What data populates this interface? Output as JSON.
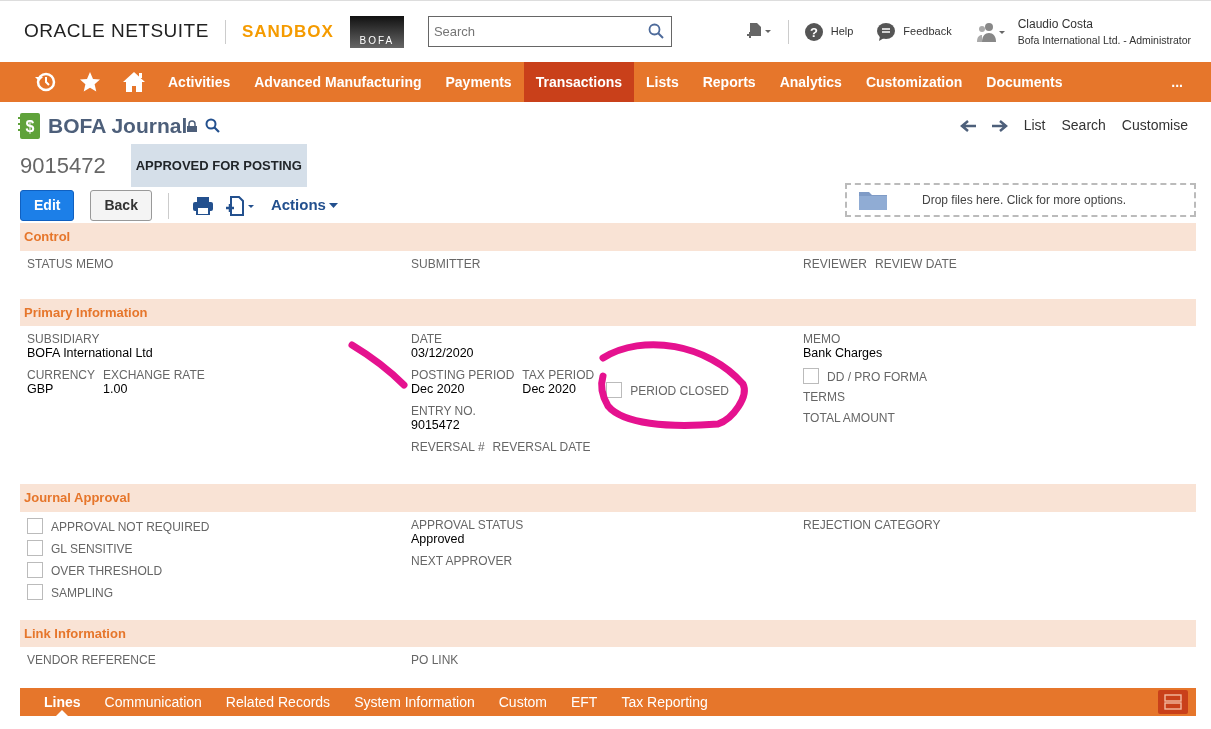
{
  "header": {
    "brand": "ORACLE NETSUITE",
    "environment": "SANDBOX",
    "company_logo": "BOFA",
    "search": {
      "placeholder": "Search"
    },
    "help_glyph": "?",
    "help": "Help",
    "feedback": "Feedback",
    "user": {
      "name": "Claudio Costa",
      "role": "Bofa International Ltd. - Administrator"
    }
  },
  "nav": {
    "items": [
      {
        "label": "Activities",
        "selected": false
      },
      {
        "label": "Advanced Manufacturing",
        "selected": false
      },
      {
        "label": "Payments",
        "selected": false
      },
      {
        "label": "Transactions",
        "selected": true
      },
      {
        "label": "Lists",
        "selected": false
      },
      {
        "label": "Reports",
        "selected": false
      },
      {
        "label": "Analytics",
        "selected": false
      },
      {
        "label": "Customization",
        "selected": false
      },
      {
        "label": "Documents",
        "selected": false
      }
    ],
    "more": "..."
  },
  "record": {
    "icon_glyph": "$",
    "type": "BOFA Journal",
    "number": "9015472",
    "status": "APPROVED FOR POSTING",
    "links": [
      "List",
      "Search",
      "Customise"
    ]
  },
  "toolbar": {
    "edit": "Edit",
    "back": "Back",
    "actions": "Actions",
    "dropzone": "Drop files here. Click for more options."
  },
  "sections": [
    {
      "title": "Control",
      "columns": [
        [
          {
            "kind": "field",
            "label": "STATUS MEMO"
          }
        ],
        [
          {
            "kind": "field",
            "label": "SUBMITTER"
          }
        ],
        [
          {
            "kind": "row",
            "fields": [
              {
                "kind": "field",
                "label": "REVIEWER"
              },
              {
                "kind": "field",
                "label": "REVIEW DATE"
              }
            ]
          }
        ]
      ]
    },
    {
      "title": "Primary Information",
      "columns": [
        [
          {
            "kind": "field",
            "label": "SUBSIDIARY",
            "value": "BOFA International Ltd"
          },
          {
            "kind": "row",
            "fields": [
              {
                "kind": "field",
                "label": "CURRENCY",
                "value": "GBP"
              },
              {
                "kind": "field",
                "label": "EXCHANGE RATE",
                "value": "1.00"
              }
            ]
          }
        ],
        [
          {
            "kind": "field",
            "label": "DATE",
            "value": "03/12/2020"
          },
          {
            "kind": "row",
            "fields": [
              {
                "kind": "field",
                "label": "POSTING PERIOD",
                "value": "Dec 2020"
              },
              {
                "kind": "field",
                "label": "TAX PERIOD",
                "value": "Dec 2020"
              },
              {
                "kind": "checkbox",
                "label": "PERIOD CLOSED",
                "checked": false
              }
            ]
          },
          {
            "kind": "field",
            "label": "ENTRY NO.",
            "value": "9015472"
          },
          {
            "kind": "row",
            "fields": [
              {
                "kind": "field",
                "label": "REVERSAL #"
              },
              {
                "kind": "field",
                "label": "REVERSAL DATE"
              }
            ]
          }
        ],
        [
          {
            "kind": "field",
            "label": "MEMO",
            "value": "Bank Charges"
          },
          {
            "kind": "checkbox",
            "label": "DD / PRO FORMA",
            "checked": false
          },
          {
            "kind": "field",
            "label": "TERMS"
          },
          {
            "kind": "field",
            "label": "TOTAL AMOUNT"
          }
        ]
      ]
    },
    {
      "title": "Journal Approval",
      "columns": [
        [
          {
            "kind": "checkbox",
            "label": "APPROVAL NOT REQUIRED",
            "checked": false
          },
          {
            "kind": "checkbox",
            "label": "GL SENSITIVE",
            "checked": false
          },
          {
            "kind": "checkbox",
            "label": "OVER THRESHOLD",
            "checked": false
          },
          {
            "kind": "checkbox",
            "label": "SAMPLING",
            "checked": false
          }
        ],
        [
          {
            "kind": "field",
            "label": "APPROVAL STATUS",
            "value": "Approved"
          },
          {
            "kind": "field",
            "label": "NEXT APPROVER"
          }
        ],
        [
          {
            "kind": "field",
            "label": "REJECTION CATEGORY"
          }
        ]
      ]
    },
    {
      "title": "Link Information",
      "columns": [
        [
          {
            "kind": "field",
            "label": "VENDOR REFERENCE"
          }
        ],
        [
          {
            "kind": "field",
            "label": "PO LINK"
          }
        ],
        []
      ]
    }
  ],
  "subtabs": [
    {
      "label": "Lines",
      "selected": true
    },
    {
      "label": "Communication",
      "selected": false
    },
    {
      "label": "Related Records",
      "selected": false
    },
    {
      "label": "System Information",
      "selected": false
    },
    {
      "label": "Custom",
      "selected": false
    },
    {
      "label": "EFT",
      "selected": false
    },
    {
      "label": "Tax Reporting",
      "selected": false
    }
  ]
}
